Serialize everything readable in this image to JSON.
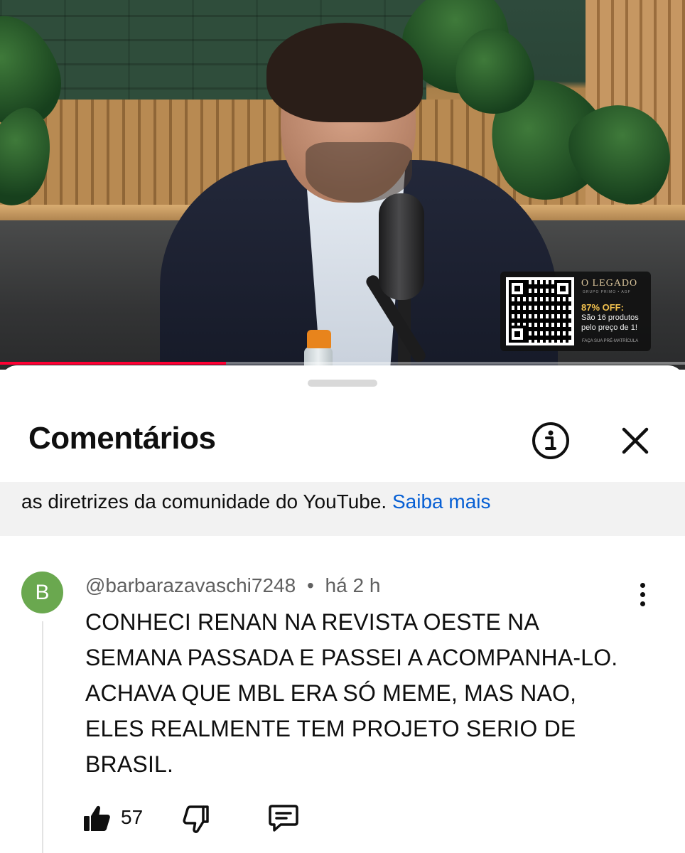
{
  "video": {
    "progress_fraction": 0.33,
    "ad": {
      "brand": "O LEGADO",
      "sub": "GRUPO PRIMO • AGF",
      "offer": "87% OFF:",
      "text": "São 16 produtos pelo preço de 1!",
      "cta": "FAÇA SUA PRÉ-MATRÍCULA"
    }
  },
  "sheet": {
    "title": "Comentários",
    "info_icon": "info-circle-icon",
    "close_icon": "close-icon",
    "notice": {
      "text": "as diretrizes da comunidade do YouTube.",
      "link": "Saiba mais"
    }
  },
  "comment": {
    "avatar_letter": "B",
    "avatar_color": "#6aa84f",
    "author": "@barbarazavaschi7248",
    "separator": "•",
    "time": "há 2 h",
    "body": "CONHECI RENAN NA REVISTA OESTE NA SEMANA PASSADA E PASSEI A ACOMPANHA-LO. ACHAVA QUE MBL ERA SÓ MEME, MAS NAO, ELES REALMENTE TEM PROJETO SERIO DE BRASIL.",
    "like_count": "57",
    "icons": [
      "thumbs-up-icon",
      "thumbs-down-icon",
      "reply-icon",
      "more-vertical-icon"
    ]
  },
  "colors": {
    "accent_link": "#065fd4",
    "progress": "#ff0033",
    "avatar": "#6aa84f"
  }
}
